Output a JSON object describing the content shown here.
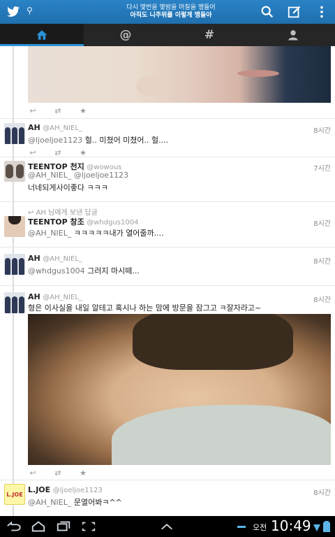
{
  "header": {
    "title_line1": "다시 몇번을 몇밤을 머칠을 맹들어",
    "title_line2": "아직도 니주위를 이렇게 맹돌아"
  },
  "tabs": [
    {
      "name": "home-icon",
      "label": ""
    },
    {
      "name": "mentions",
      "label": "@"
    },
    {
      "name": "hashtags",
      "label": "#"
    },
    {
      "name": "profile-icon",
      "label": ""
    }
  ],
  "tweets": [
    {
      "name": "AH",
      "handle": "@AH_NIEL_",
      "time": "8시간",
      "text_mention": "@ljoeljoe1123",
      "text": " 헐.. 미쳤어 미쳤어.. 헐...."
    },
    {
      "name": "TEENTOP 천지",
      "handle": "@wowous",
      "time": "7시간",
      "mentions": "@AH_NIEL_ @ljoeljoe1123",
      "text": "너네되게사이좋다 ㅋㅋㅋ"
    },
    {
      "reply_line": "AH 님에게 보낸 답글",
      "name": "TEENTOP 창조",
      "handle": "@whdgus1004",
      "time": "8시간",
      "text_mention": "@AH_NIEL_",
      "text": " ㅋㅋㅋㅋㅋ내가 열어줄까...."
    },
    {
      "name": "AH",
      "handle": "@AH_NIEL_",
      "time": "8시간",
      "text_mention": "@whdgus1004",
      "text": " 그러지 마시떼..."
    },
    {
      "name": "AH",
      "handle": "@AH_NIEL_",
      "time": "8시간",
      "text": "형은 이사실을 내일 알테고 혹시나 하는 맘에 방문을 잠그고 ㅋ잘자라고~"
    },
    {
      "name": "L.JOE",
      "handle": "@ljoeljoe1123",
      "time": "8시간",
      "text_mention": "@AH_NIEL_",
      "text": " 문열어봐ㅋ^^",
      "avatar_text": "L.JOE"
    }
  ],
  "statusbar": {
    "ampm": "오전",
    "clock": "10:49"
  },
  "colors": {
    "topbar": "#2a83c6",
    "tabbar": "#262626",
    "accent": "#2b92d8"
  }
}
